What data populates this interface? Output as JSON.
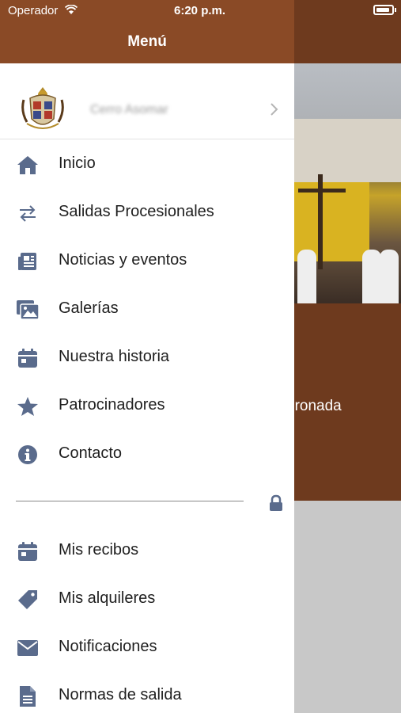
{
  "status_bar": {
    "carrier": "Operador",
    "time": "6:20 p.m."
  },
  "drawer": {
    "title": "Menú",
    "profile": {
      "name": "Cerro Asomar"
    },
    "items": [
      {
        "label": "Inicio",
        "icon": "home-icon"
      },
      {
        "label": "Salidas Procesionales",
        "icon": "swap-arrows-icon"
      },
      {
        "label": "Noticias y eventos",
        "icon": "newspaper-icon"
      },
      {
        "label": "Galerías",
        "icon": "images-icon"
      },
      {
        "label": "Nuestra historia",
        "icon": "calendar-icon"
      },
      {
        "label": "Patrocinadores",
        "icon": "star-icon"
      },
      {
        "label": "Contacto",
        "icon": "info-icon"
      }
    ],
    "private_items": [
      {
        "label": "Mis recibos",
        "icon": "calendar-icon"
      },
      {
        "label": "Mis alquileres",
        "icon": "tag-icon"
      },
      {
        "label": "Notificaciones",
        "icon": "envelope-icon"
      },
      {
        "label": "Normas de salida",
        "icon": "document-icon"
      }
    ]
  },
  "background": {
    "caption_fragment": "oronada"
  },
  "colors": {
    "drawer_header": "#8a4a26",
    "app_header": "#6e3a1e",
    "icon": "#5a6b8c"
  }
}
